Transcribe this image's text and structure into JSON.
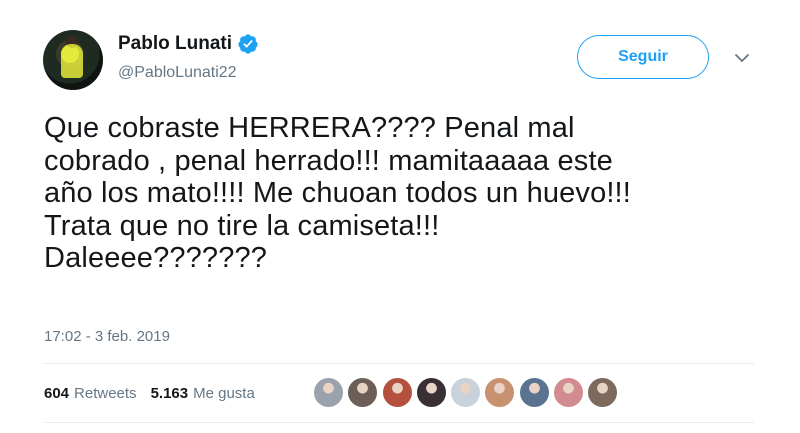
{
  "user": {
    "name": "Pablo Lunati",
    "handle": "@PabloLunati22",
    "verified": true
  },
  "follow_button": {
    "label": "Seguir"
  },
  "tweet": {
    "lines": [
      "Que cobraste HERRERA???? Penal mal",
      "cobrado , penal herrado!!! mamitaaaaa este",
      "año los mato!!!! Me chuoan todos un huevo!!!",
      "Trata que no tire la camiseta!!!",
      "Daleeee???????"
    ],
    "timestamp": "17:02 - 3 feb. 2019"
  },
  "stats": {
    "retweets_count": "604",
    "retweets_label": "Retweets",
    "likes_count": "5.163",
    "likes_label": "Me gusta"
  },
  "likers": [
    {
      "name": "liker-1",
      "color": "#9aa3ad"
    },
    {
      "name": "liker-2",
      "color": "#6b5f58"
    },
    {
      "name": "liker-3",
      "color": "#b4503e"
    },
    {
      "name": "liker-4",
      "color": "#3a2f35"
    },
    {
      "name": "liker-5",
      "color": "#c9d1da"
    },
    {
      "name": "liker-6",
      "color": "#c89270"
    },
    {
      "name": "liker-7",
      "color": "#5a7391"
    },
    {
      "name": "liker-8",
      "color": "#d28b8f"
    },
    {
      "name": "liker-9",
      "color": "#7d6a5c"
    }
  ],
  "colors": {
    "accent": "#1da1f2",
    "text": "#14171a",
    "secondary": "#657786",
    "divider": "#e6ecf0"
  },
  "icons": {
    "verified": "verified-badge-icon",
    "caret": "chevron-down-icon"
  }
}
